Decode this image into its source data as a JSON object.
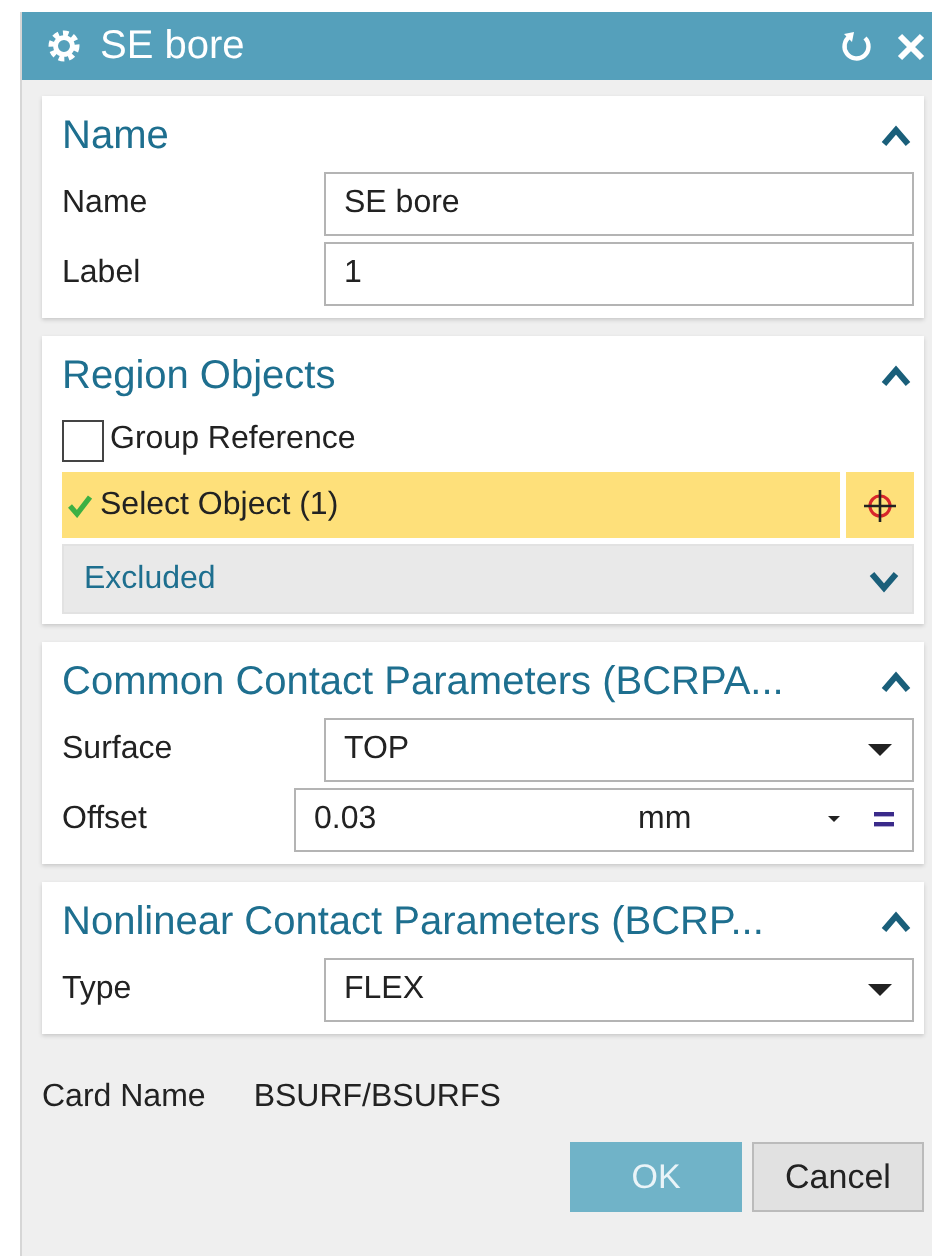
{
  "window": {
    "title": "SE bore"
  },
  "sections": [
    {
      "title": "Name",
      "expanded": true,
      "rows": [
        {
          "kind": "text",
          "label": "Name",
          "value": "SE bore"
        },
        {
          "kind": "text",
          "label": "Label",
          "value": "1"
        }
      ]
    },
    {
      "title": "Region Objects",
      "expanded": true,
      "rows": [
        {
          "kind": "checkbox",
          "label": "Group Reference",
          "checked": false
        },
        {
          "kind": "selection",
          "label": "Select Object (1)",
          "active": true,
          "satisfied": true
        },
        {
          "kind": "group",
          "label": "Excluded",
          "expanded": false
        }
      ]
    },
    {
      "title": "Common Contact Parameters (BCRPA...",
      "expanded": true,
      "rows": [
        {
          "kind": "dropdown",
          "label": "Surface",
          "value": "TOP"
        },
        {
          "kind": "expression",
          "label": "Offset",
          "value": "0.03",
          "unit": "mm"
        }
      ]
    },
    {
      "title": "Nonlinear Contact Parameters (BCRP...",
      "expanded": true,
      "rows": [
        {
          "kind": "dropdown",
          "label": "Type",
          "value": "FLEX"
        }
      ]
    }
  ],
  "card": {
    "label": "Card Name",
    "value": "BSURF/BSURFS"
  },
  "buttons": [
    {
      "label": "OK",
      "kind": "primary"
    },
    {
      "label": "Cancel",
      "kind": "secondary"
    }
  ]
}
